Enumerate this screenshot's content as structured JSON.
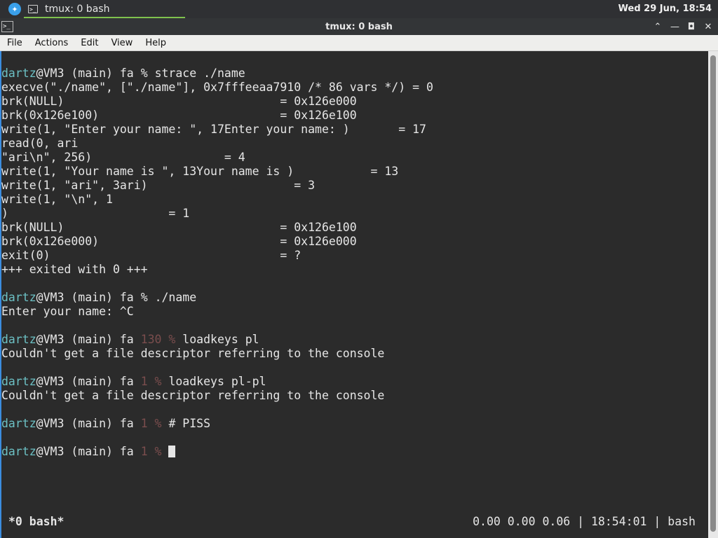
{
  "panel": {
    "task_label": "tmux: 0 bash",
    "clock": "Wed 29 Jun, 18:54"
  },
  "window": {
    "title": "tmux: 0 bash",
    "controls": [
      "⌃",
      "—",
      "◘",
      "✕"
    ]
  },
  "menu": [
    "File",
    "Actions",
    "Edit",
    "View",
    "Help"
  ],
  "terminal": {
    "prompt_user": "dartz",
    "prompt_host": "@VM3 (main) fa",
    "lines": [
      "",
      "execve(\"./name\", [\"./name\"], 0x7fffeeaa7910 /* 86 vars */) = 0",
      "brk(NULL)                               = 0x126e000",
      "brk(0x126e100)                          = 0x126e100",
      "write(1, \"Enter your name: \", 17Enter your name: )       = 17",
      "read(0, ari",
      "\"ari\\n\", 256)                   = 4",
      "write(1, \"Your name is \", 13Your name is )           = 13",
      "write(1, \"ari\", 3ari)                     = 3",
      "write(1, \"\\n\", 1",
      ")                       = 1",
      "brk(NULL)                               = 0x126e100",
      "brk(0x126e000)                          = 0x126e000",
      "exit(0)                                 = ?",
      "+++ exited with 0 +++",
      "",
      "",
      "Enter your name: ^C",
      "",
      "",
      "Couldn't get a file descriptor referring to the console",
      "",
      "",
      "Couldn't get a file descriptor referring to the console",
      "",
      "",
      "",
      ""
    ],
    "prompts": [
      {
        "row": 0,
        "code": "",
        "sep": " % ",
        "cmd": "strace ./name"
      },
      {
        "row": 16,
        "code": "",
        "sep": " % ",
        "cmd": "./name"
      },
      {
        "row": 19,
        "code": "130",
        "sep": " % ",
        "cmd": "loadkeys pl"
      },
      {
        "row": 22,
        "code": "1",
        "sep": " % ",
        "cmd": "loadkeys pl-pl"
      },
      {
        "row": 25,
        "code": "1",
        "sep": " % ",
        "cmd": "# PISS"
      },
      {
        "row": 27,
        "code": "1",
        "sep": " % ",
        "cmd": ""
      }
    ]
  },
  "tmux_status": {
    "left": "*0 bash*",
    "right": "0.00 0.00 0.06 | 18:54:01 | bash"
  }
}
